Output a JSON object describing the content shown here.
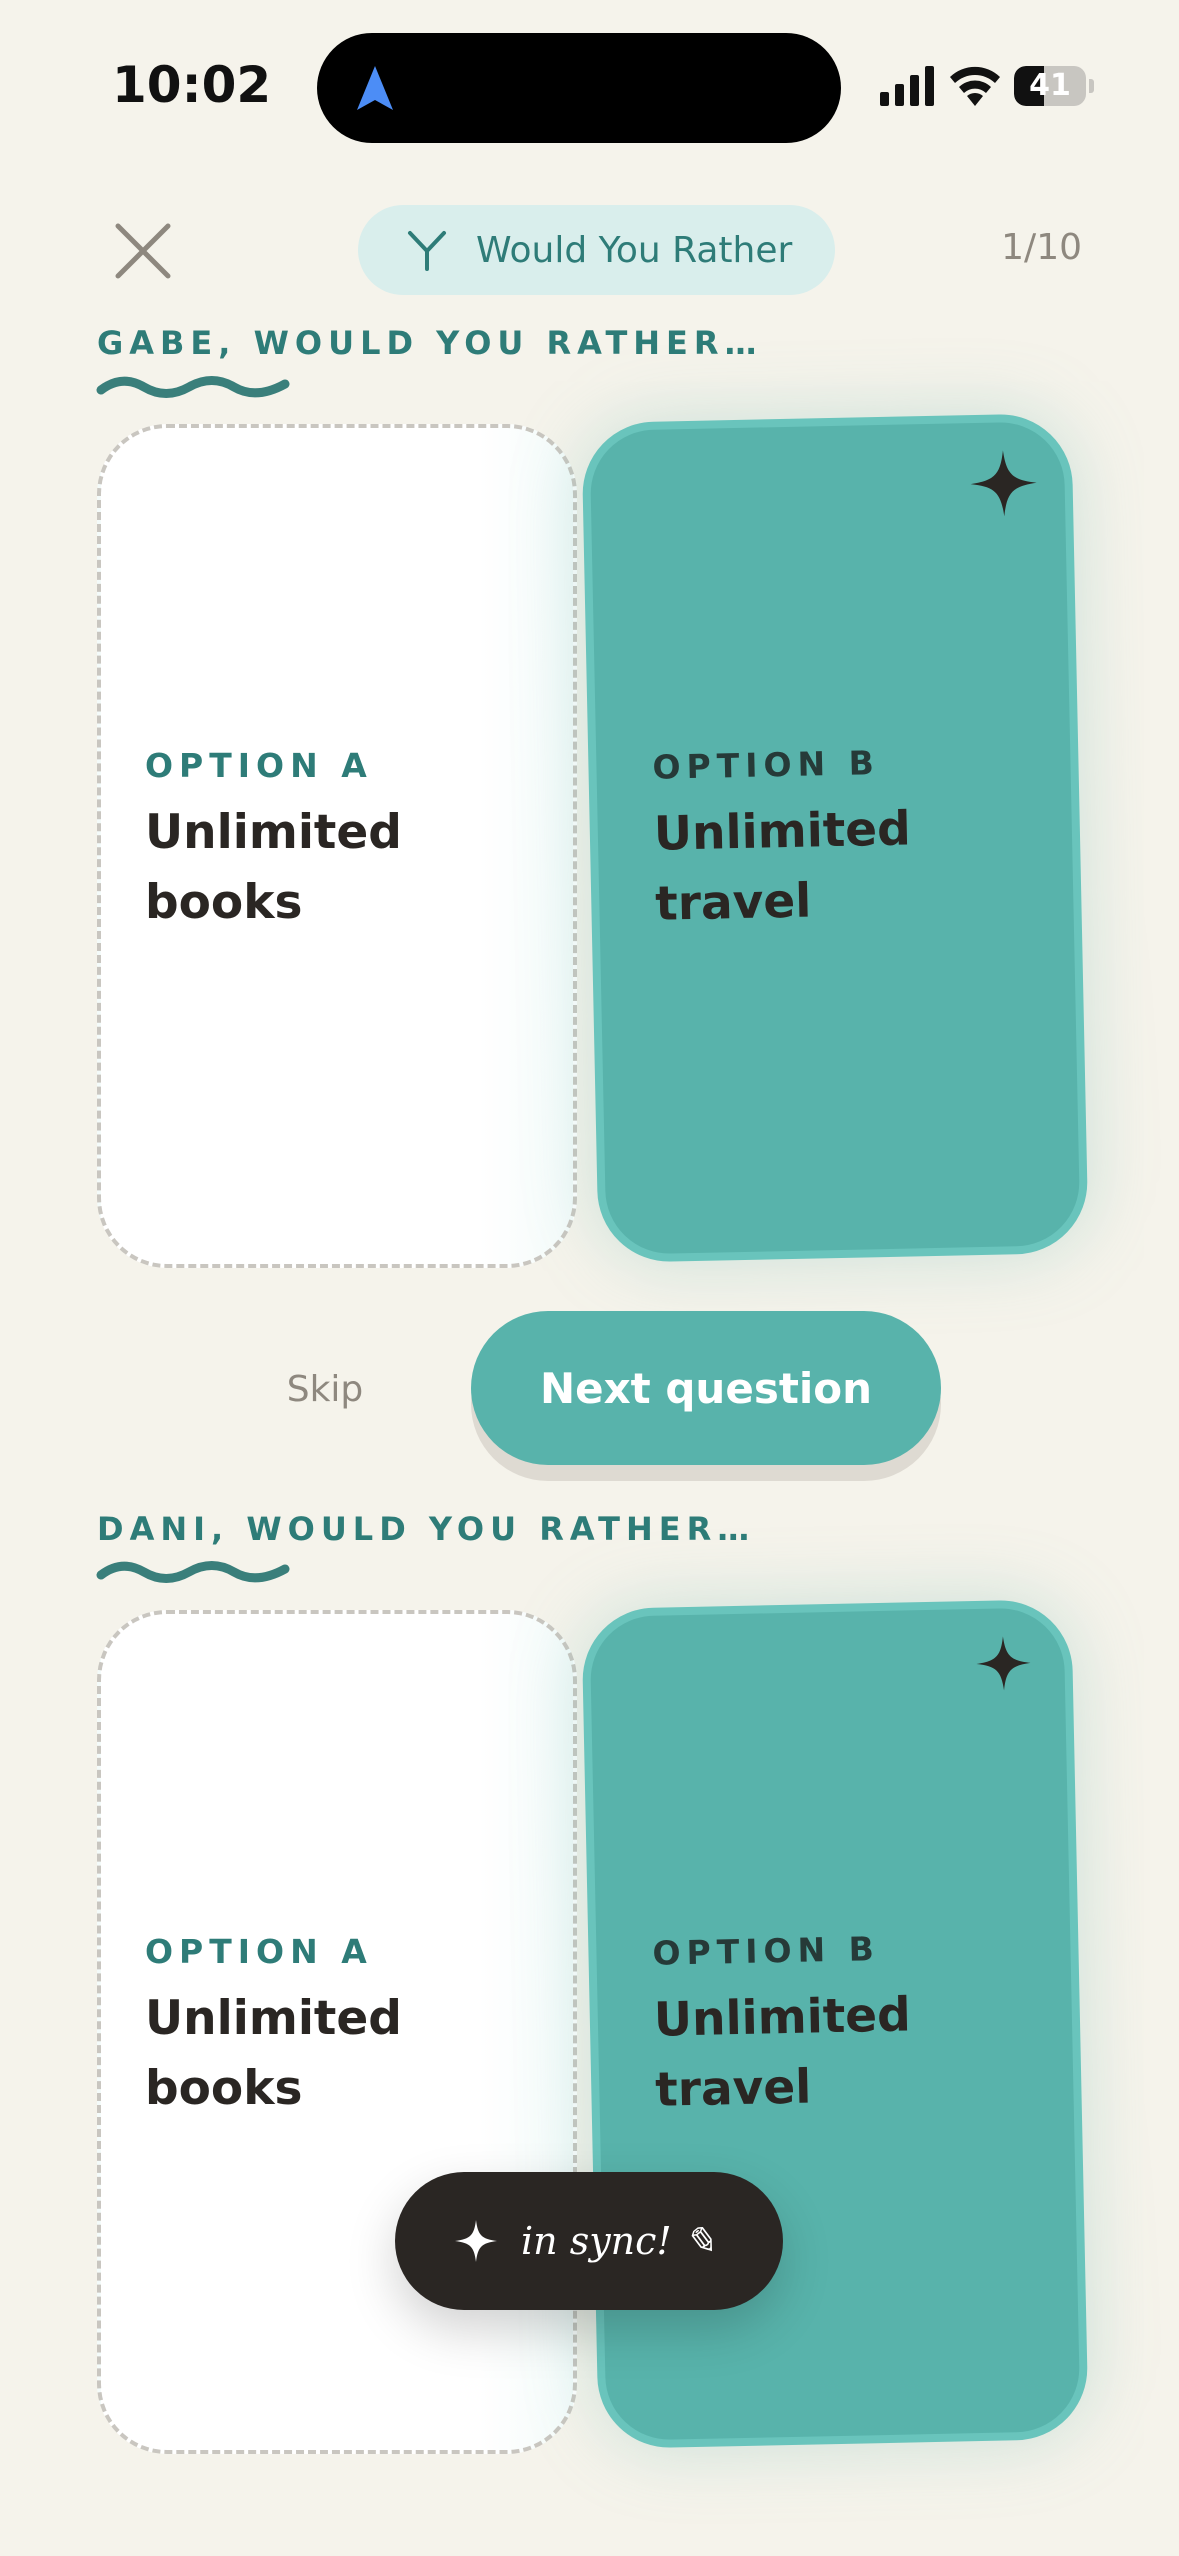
{
  "status_bar": {
    "time": "10:02",
    "battery_level": "41",
    "battery_fraction": 0.41
  },
  "header": {
    "close_icon": "close-icon",
    "game_icon": "y-letter-icon",
    "game_title": "Would You Rather",
    "progress": "1/10"
  },
  "sections": [
    {
      "heading": "GABE, WOULD YOU RATHER…",
      "option_a": {
        "label": "OPTION A",
        "text": "Unlimited books"
      },
      "option_b": {
        "label": "OPTION B",
        "text": "Unlimited travel"
      }
    },
    {
      "heading": "DANI, WOULD YOU RATHER…",
      "option_a": {
        "label": "OPTION A",
        "text": "Unlimited books"
      },
      "option_b": {
        "label": "OPTION B",
        "text": "Unlimited travel"
      }
    }
  ],
  "actions": {
    "skip_label": "Skip",
    "next_label": "Next question"
  },
  "toast": {
    "icon": "sparkle-icon",
    "text": "in sync! ✎"
  },
  "colors": {
    "background": "#F5F3EB",
    "accent": "#58B3AB",
    "accent_dark": "#2E7C78",
    "ink": "#2A2623",
    "pill_bg": "#D9EEEC"
  }
}
